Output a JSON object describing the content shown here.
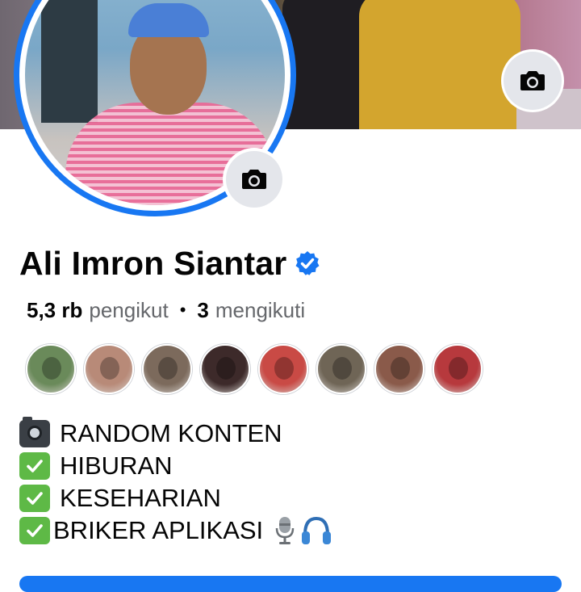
{
  "profile": {
    "name": "Ali Imron Siantar",
    "verified_icon": "verified-badge-icon",
    "followers_count": "5,3 rb",
    "followers_label": "pengikut",
    "separator": "•",
    "following_count": "3",
    "following_label": "mengikuti"
  },
  "bio": {
    "lines": [
      {
        "emoji": "camera-emoji",
        "text": "RANDOM KONTEN"
      },
      {
        "emoji": "check-mark-emoji",
        "text": "HIBURAN"
      },
      {
        "emoji": "check-mark-emoji",
        "text": "KESEHARIAN"
      },
      {
        "emoji": "check-mark-emoji",
        "text": "BRIKER APLIKASI"
      }
    ],
    "trailing_emojis": [
      "microphone-emoji",
      "headphones-emoji"
    ]
  },
  "followers_preview": {
    "count_shown": 8,
    "avatar_colors": [
      "#6a8a5a",
      "#b88a78",
      "#7c6a5c",
      "#3d2a2a",
      "#c94a45",
      "#6f6556",
      "#8a5a4a",
      "#b7393d"
    ]
  },
  "colors": {
    "accent": "#1877f2",
    "text_primary": "#050505",
    "text_secondary": "#65676b",
    "icon_button_bg": "#e4e6eb"
  }
}
